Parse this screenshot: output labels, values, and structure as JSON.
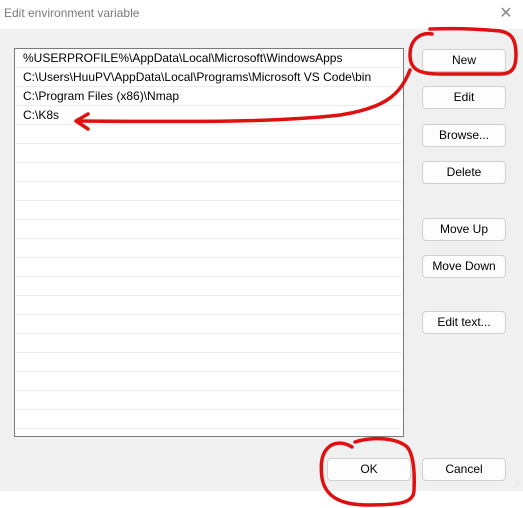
{
  "window": {
    "title": "Edit environment variable",
    "close_icon": "close-icon"
  },
  "list": {
    "items": [
      "%USERPROFILE%\\AppData\\Local\\Microsoft\\WindowsApps",
      "C:\\Users\\HuuPV\\AppData\\Local\\Programs\\Microsoft VS Code\\bin",
      "C:\\Program Files (x86)\\Nmap",
      "C:\\K8s",
      "",
      "",
      "",
      "",
      "",
      "",
      "",
      "",
      "",
      "",
      "",
      "",
      "",
      "",
      "",
      ""
    ]
  },
  "buttons": {
    "new": "New",
    "edit": "Edit",
    "browse": "Browse...",
    "delete": "Delete",
    "move_up": "Move Up",
    "move_down": "Move Down",
    "edit_text": "Edit text...",
    "ok": "OK",
    "cancel": "Cancel"
  },
  "annotations": {
    "color": "#e01010",
    "marks": [
      "circle-around-new-button",
      "arrow-from-new-to-k8s-entry",
      "circle-around-ok-button"
    ]
  }
}
